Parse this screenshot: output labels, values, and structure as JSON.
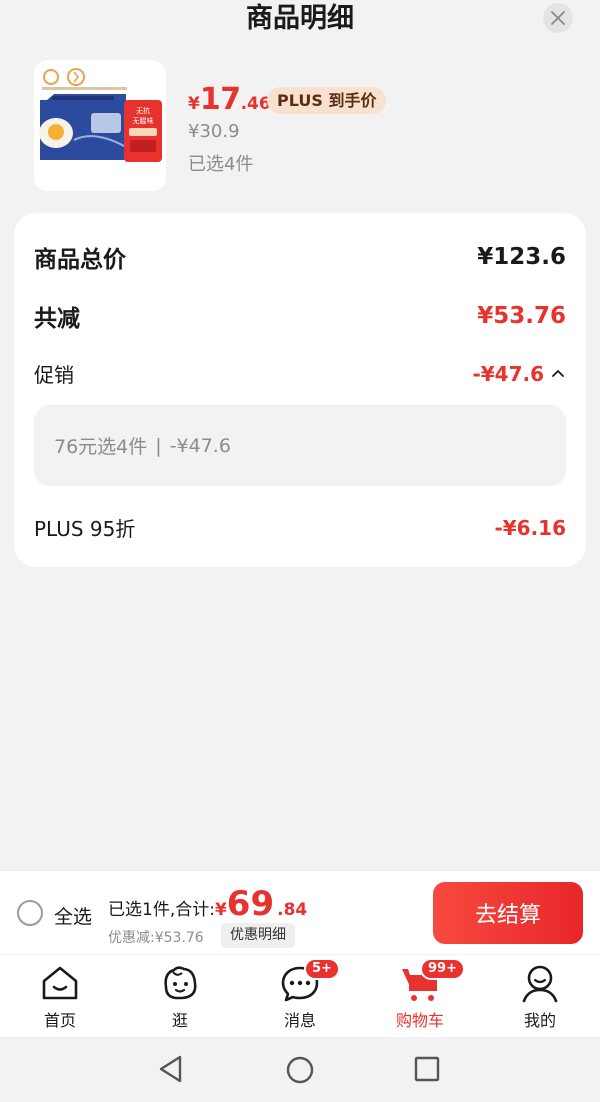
{
  "header": {
    "title": "商品明细"
  },
  "product": {
    "yen": "¥",
    "price_int": "17",
    "price_dec": ".46",
    "plus_tag": "PLUS 到手价",
    "original_price": "¥30.9",
    "selected_count": "已选4件"
  },
  "details": {
    "total_label": "商品总价",
    "total_value": "¥123.6",
    "reduced_label": "共减",
    "reduced_value": "¥53.76",
    "promo_label": "促销",
    "promo_value": "-¥47.6",
    "promo_desc_main": "76元选4件",
    "promo_desc_sep": "|",
    "promo_desc_value": "-¥47.6",
    "plus_label": "PLUS 95折",
    "plus_value": "-¥6.16"
  },
  "checkout": {
    "select_all": "全选",
    "summary_prefix": "已选1件,合计:",
    "yen": "¥",
    "total_int": "69",
    "total_dec": ".84",
    "discount": "优惠减:¥53.76",
    "discount_detail": "优惠明细",
    "checkout_button": "去结算"
  },
  "tabs": [
    {
      "label": "首页",
      "icon": "home-icon",
      "badge": ""
    },
    {
      "label": "逛",
      "icon": "browse-face-icon",
      "badge": ""
    },
    {
      "label": "消息",
      "icon": "message-icon",
      "badge": "5+"
    },
    {
      "label": "购物车",
      "icon": "cart-icon",
      "badge": "99+",
      "active": true
    },
    {
      "label": "我的",
      "icon": "profile-icon",
      "badge": ""
    }
  ],
  "colors": {
    "accent": "#e8322d",
    "plus_tag_bg": "#f9e1cf",
    "page_bg": "#f2f2f2"
  }
}
